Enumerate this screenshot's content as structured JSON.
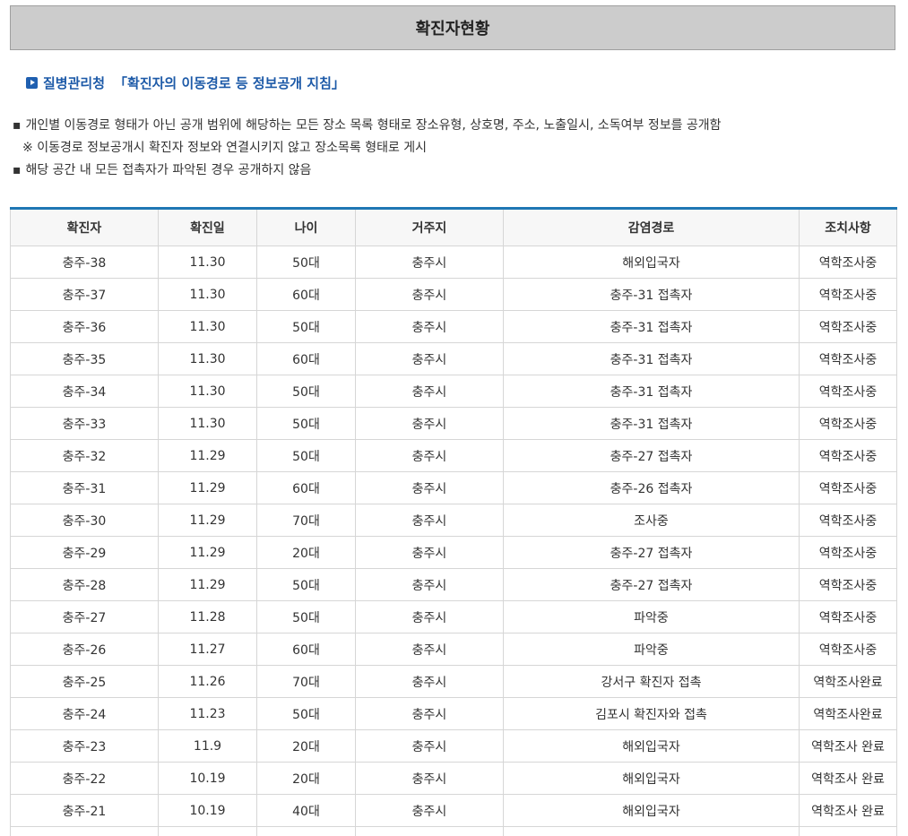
{
  "page": {
    "title": "확진자현황",
    "subhead_org": "질병관리청",
    "subhead_guide": "「확진자의 이동경로 등 정보공개 지침」",
    "notes": [
      {
        "mark": "▪",
        "text": "개인별 이동경로 형태가 아닌 공개 범위에 해당하는 모든 장소 목록 형태로 장소유형, 상호명, 주소, 노출일시, 소독여부 정보를 공개함"
      },
      {
        "mark": "※",
        "text": "이동경로 정보공개시 확진자 정보와 연결시키지 않고 장소목록 형태로 게시"
      },
      {
        "mark": "▪",
        "text": "해당 공간 내 모든 접촉자가 파악된 경우 공개하지 않음"
      }
    ],
    "accent_color": "#1f77b4",
    "subhead_color": "#1d5aa8"
  },
  "table": {
    "headers": [
      "확진자",
      "확진일",
      "나이",
      "거주지",
      "감염경로",
      "조치사항"
    ],
    "rows": [
      [
        "충주-38",
        "11.30",
        "50대",
        "충주시",
        "해외입국자",
        "역학조사중"
      ],
      [
        "충주-37",
        "11.30",
        "60대",
        "충주시",
        "충주-31 접촉자",
        "역학조사중"
      ],
      [
        "충주-36",
        "11.30",
        "50대",
        "충주시",
        "충주-31 접촉자",
        "역학조사중"
      ],
      [
        "충주-35",
        "11.30",
        "60대",
        "충주시",
        "충주-31 접촉자",
        "역학조사중"
      ],
      [
        "충주-34",
        "11.30",
        "50대",
        "충주시",
        "충주-31 접촉자",
        "역학조사중"
      ],
      [
        "충주-33",
        "11.30",
        "50대",
        "충주시",
        "충주-31 접촉자",
        "역학조사중"
      ],
      [
        "충주-32",
        "11.29",
        "50대",
        "충주시",
        "충주-27 접촉자",
        "역학조사중"
      ],
      [
        "충주-31",
        "11.29",
        "60대",
        "충주시",
        "충주-26 접촉자",
        "역학조사중"
      ],
      [
        "충주-30",
        "11.29",
        "70대",
        "충주시",
        "조사중",
        "역학조사중"
      ],
      [
        "충주-29",
        "11.29",
        "20대",
        "충주시",
        "충주-27 접촉자",
        "역학조사중"
      ],
      [
        "충주-28",
        "11.29",
        "50대",
        "충주시",
        "충주-27 접촉자",
        "역학조사중"
      ],
      [
        "충주-27",
        "11.28",
        "50대",
        "충주시",
        "파악중",
        "역학조사중"
      ],
      [
        "충주-26",
        "11.27",
        "60대",
        "충주시",
        "파악중",
        "역학조사중"
      ],
      [
        "충주-25",
        "11.26",
        "70대",
        "충주시",
        "강서구 확진자 접촉",
        "역학조사완료"
      ],
      [
        "충주-24",
        "11.23",
        "50대",
        "충주시",
        "김포시 확진자와 접촉",
        "역학조사완료"
      ],
      [
        "충주-23",
        "11.9",
        "20대",
        "충주시",
        "해외입국자",
        "역학조사 완료"
      ],
      [
        "충주-22",
        "10.19",
        "20대",
        "충주시",
        "해외입국자",
        "역학조사 완료"
      ],
      [
        "충주-21",
        "10.19",
        "40대",
        "충주시",
        "해외입국자",
        "역학조사 완료"
      ],
      [
        "",
        "",
        "",
        "",
        "",
        ""
      ]
    ]
  }
}
